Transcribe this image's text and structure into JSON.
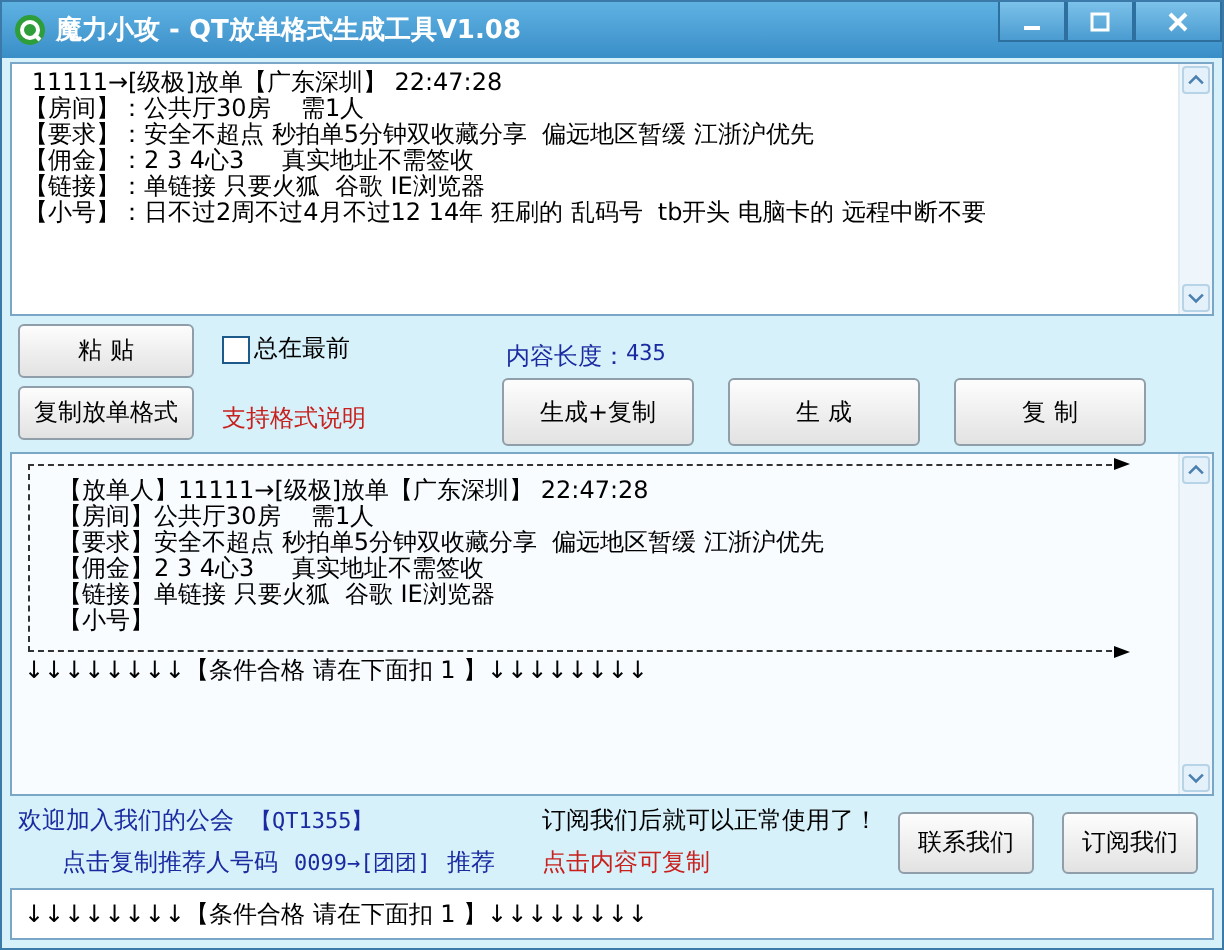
{
  "window": {
    "title": "魔力小攻 - QT放单格式生成工具V1.08"
  },
  "input_box": {
    "lines": [
      " 11111→[级极]放单【广东深圳】 22:47:28",
      "【房间】：公共厅30房    需1人",
      "【要求】：安全不超点 秒拍单5分钟双收藏分享  偏远地区暂缓 江浙沪优先",
      "【佣金】：2 3 4心3     真实地址不需签收",
      "【链接】：单链接 只要火狐  谷歌 IE浏览器",
      "【小号】：日不过2周不过4月不过12 14年 狂刷的 乱码号  tb开头 电脑卡的 远程中断不要"
    ]
  },
  "controls": {
    "paste_button": "粘 贴",
    "copy_format_button": "复制放单格式",
    "always_on_top": {
      "label": "总在最前",
      "checked": false
    },
    "format_help_link": "支持格式说明",
    "content_length": {
      "label": "内容长度：",
      "value": "435"
    },
    "action_buttons": [
      "生成+复制",
      "生 成",
      "复 制"
    ]
  },
  "output_box": {
    "framed_lines": [
      "【放单人】11111→[级极]放单【广东深圳】 22:47:28",
      "【房间】公共厅30房    需1人",
      "【要求】安全不超点 秒拍单5分钟双收藏分享  偏远地区暂缓 江浙沪优先",
      "【佣金】2 3 4心3     真实地址不需签收",
      "【链接】单链接 只要火狐  谷歌 IE浏览器",
      "【小号】"
    ],
    "footer_line": "↓↓↓↓↓↓↓↓【条件合格 请在下面扣 1 】↓↓↓↓↓↓↓↓"
  },
  "footer": {
    "welcome": "欢迎加入我们的公会",
    "guild_id": "【QT1355】",
    "copy_referrer": "点击复制推荐人号码",
    "referrer": "0099→[团团]",
    "recommend": "推荐",
    "subscribe_notice": "订阅我们后就可以正常使用了！",
    "click_copy_hint": "点击内容可复制",
    "buttons": [
      "联系我们",
      "订阅我们"
    ]
  },
  "bottom_field": {
    "value": "↓↓↓↓↓↓↓↓【条件合格 请在下面扣 1 】↓↓↓↓↓↓↓↓"
  }
}
